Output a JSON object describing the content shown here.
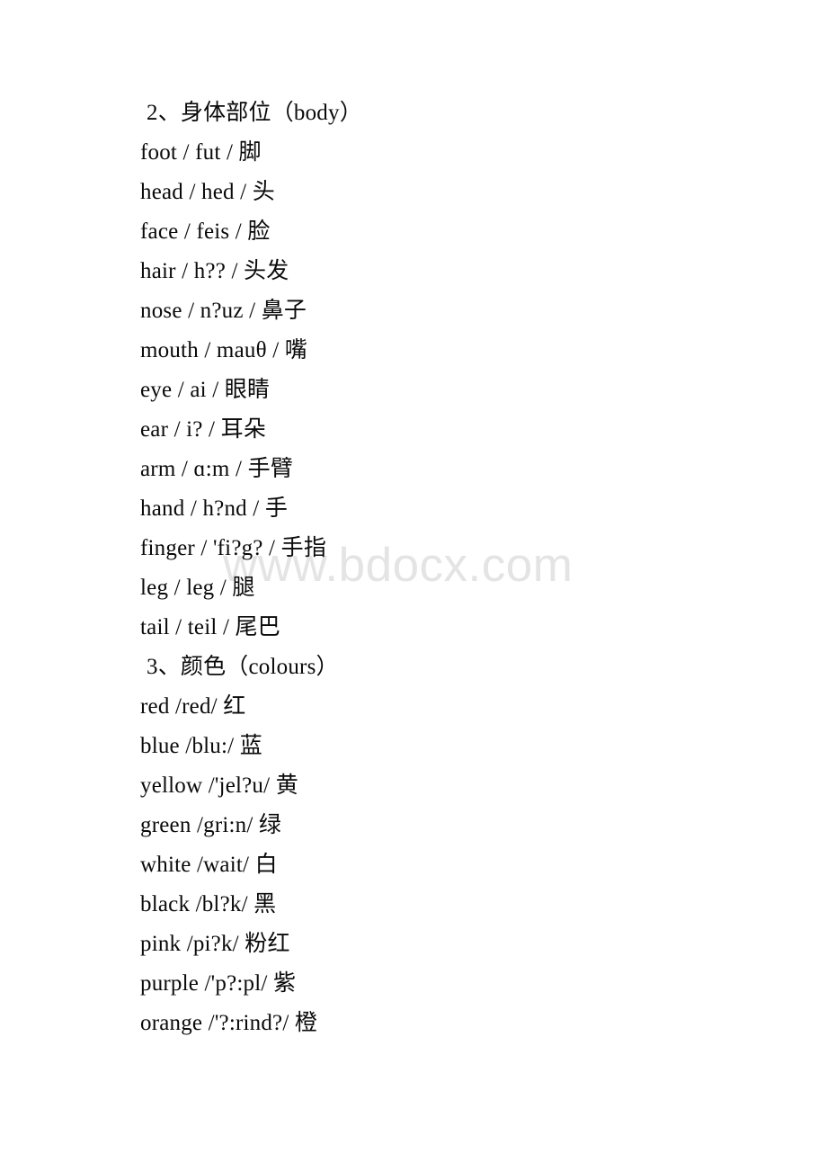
{
  "document": {
    "watermark": "www.bdocx.com",
    "background_color": "#ffffff",
    "text_color": "#0a0a0a",
    "watermark_color": "#e4e4e4"
  },
  "sections": [
    {
      "heading": "2、身体部位（body）",
      "entries": [
        {
          "line": "foot / fut / 脚"
        },
        {
          "line": "head / hed / 头"
        },
        {
          "line": "face / feis / 脸"
        },
        {
          "line": "hair / h?? / 头发"
        },
        {
          "line": "nose / n?uz / 鼻子"
        },
        {
          "line": "mouth / mauθ / 嘴"
        },
        {
          "line": "eye / ai / 眼睛"
        },
        {
          "line": "ear / i? / 耳朵"
        },
        {
          "line": "arm / ɑ:m / 手臂"
        },
        {
          "line": "hand / h?nd / 手"
        },
        {
          "line": "finger / 'fi?g? / 手指"
        },
        {
          "line": "leg / leg / 腿"
        },
        {
          "line": "tail / teil / 尾巴"
        }
      ]
    },
    {
      "heading": "3、颜色（colours）",
      "entries": [
        {
          "line": "red /red/ 红"
        },
        {
          "line": "blue /blu:/ 蓝"
        },
        {
          "line": "yellow /'jel?u/ 黄"
        },
        {
          "line": "green /gri:n/ 绿"
        },
        {
          "line": "white /wait/ 白"
        },
        {
          "line": "black /bl?k/ 黑"
        },
        {
          "line": "pink /pi?k/ 粉红"
        },
        {
          "line": "purple /'p?:pl/ 紫"
        },
        {
          "line": "orange /'?:rind?/ 橙"
        }
      ]
    }
  ]
}
